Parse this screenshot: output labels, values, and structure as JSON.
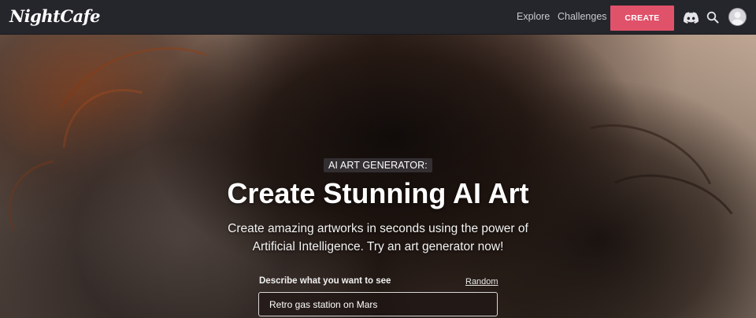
{
  "header": {
    "logo": "NightCafe",
    "nav": {
      "explore": "Explore",
      "challenges": "Challenges"
    },
    "create_label": "CREATE",
    "icons": {
      "discord": "discord-icon",
      "search": "search-icon",
      "avatar": "user-avatar-icon"
    }
  },
  "hero": {
    "badge": "AI ART GENERATOR:",
    "title": "Create Stunning AI Art",
    "subtitle": "Create amazing artworks in seconds using the power of Artificial Intelligence. Try an art generator now!",
    "prompt_label": "Describe what you want to see",
    "random_label": "Random",
    "prompt_value": "Retro gas station on Mars"
  },
  "colors": {
    "navbar_bg": "#25262b",
    "accent": "#e0516a"
  }
}
